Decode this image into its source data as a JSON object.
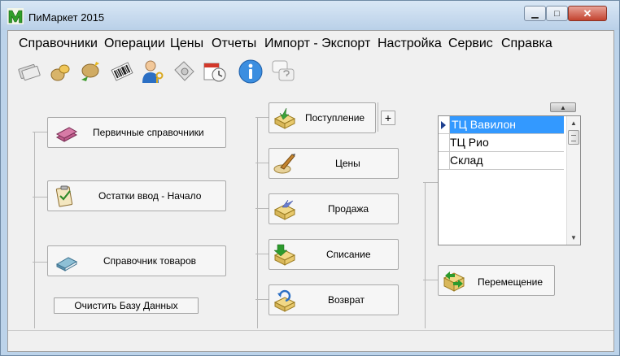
{
  "window": {
    "title": "ПиМаркет 2015"
  },
  "menu": [
    "Справочники",
    "Операции",
    "Цены",
    "Отчеты",
    "Импорт - Экспорт",
    "Настройка",
    "Сервис",
    "Справка"
  ],
  "toolbar": [
    "money-icon",
    "coins-icon",
    "coins-exchange-icon",
    "barcode-icon",
    "user-key-icon",
    "scale-icon",
    "calendar-clock-icon",
    "info-icon",
    "help-icon"
  ],
  "left_buttons": {
    "directories": "Первичные справочники",
    "opening_balances": "Остатки ввод - Начало",
    "products": "Справочник товаров",
    "clear_db": "Очистить Базу Данных"
  },
  "middle_buttons": {
    "receipt": "Поступление",
    "expand": "+",
    "prices": "Цены",
    "sale": "Продажа",
    "writeoff": "Списание",
    "return": "Возврат"
  },
  "stores": [
    "ТЦ Вавилон",
    "ТЦ Рио",
    "Склад"
  ],
  "transfer": "Перемещение"
}
